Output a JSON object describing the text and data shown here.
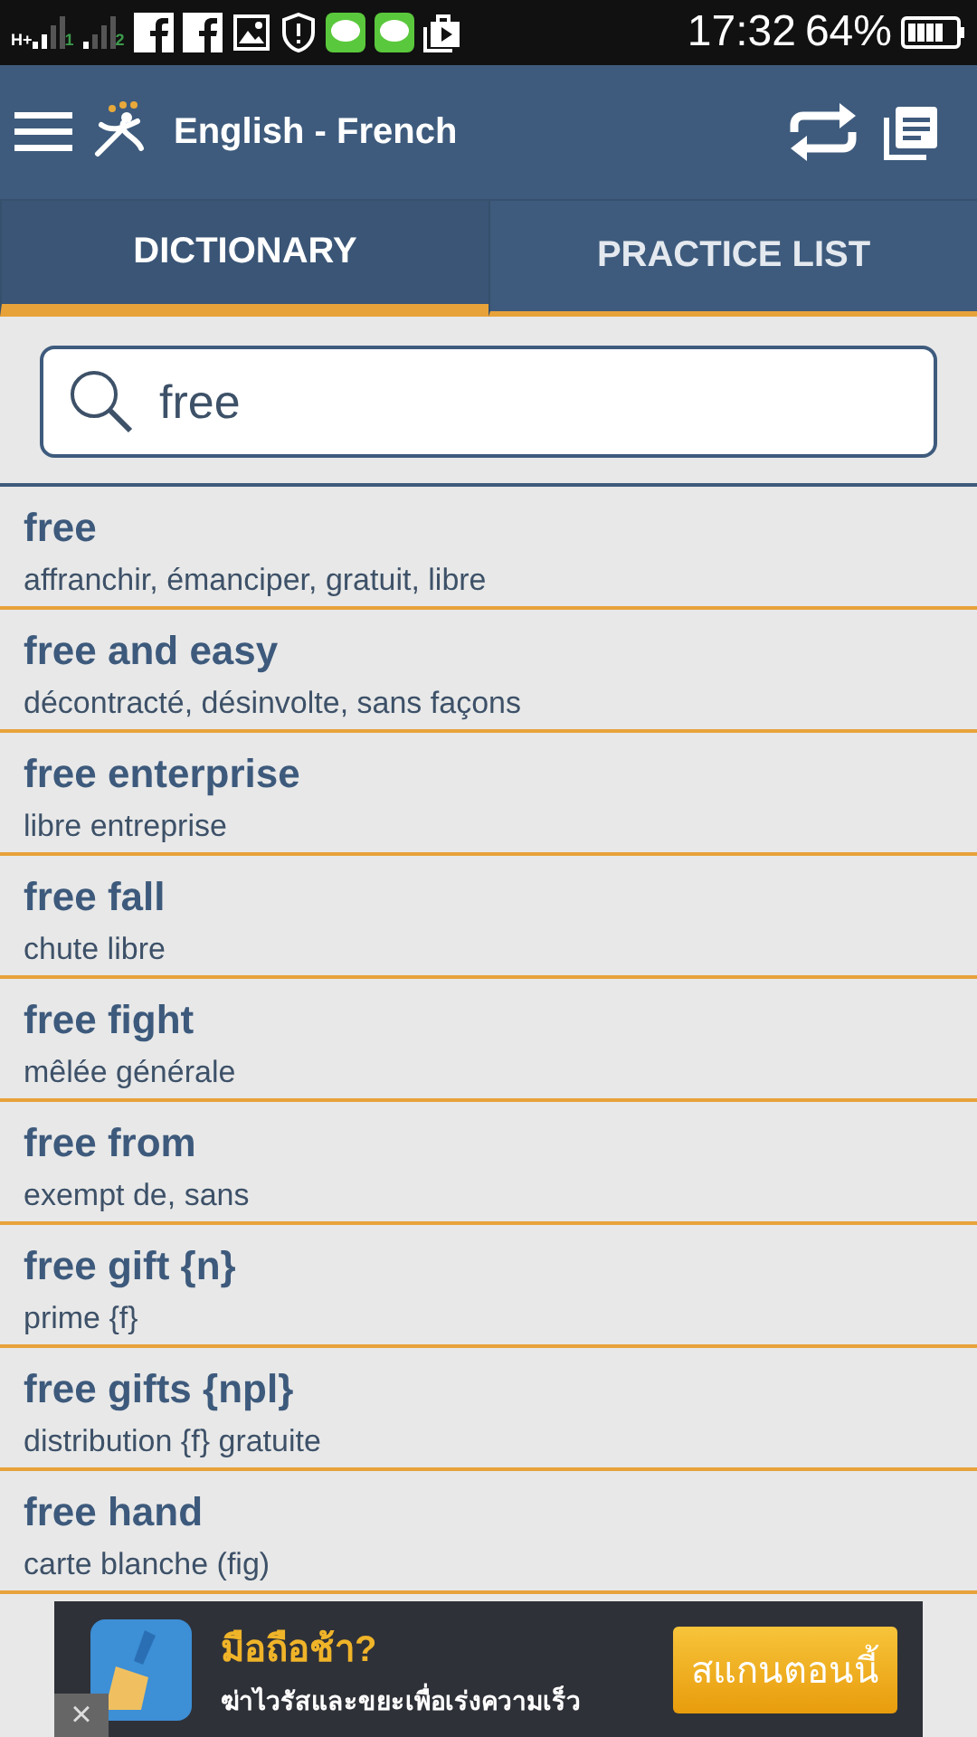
{
  "status_bar": {
    "network": "H+",
    "sim_1": "1",
    "sim_2": "2",
    "time": "17:32",
    "battery": "64%"
  },
  "app_bar": {
    "title": "English - French"
  },
  "tabs": [
    {
      "label": "DICTIONARY",
      "selected": true
    },
    {
      "label": "PRACTICE LIST",
      "selected": false
    }
  ],
  "search": {
    "value": "free"
  },
  "results": [
    {
      "term": "free",
      "translation": "affranchir, émanciper, gratuit, libre"
    },
    {
      "term": "free and easy",
      "translation": "décontracté, désinvolte, sans façons"
    },
    {
      "term": "free enterprise",
      "translation": "libre entreprise"
    },
    {
      "term": "free fall",
      "translation": "chute libre"
    },
    {
      "term": "free fight",
      "translation": "mêlée générale"
    },
    {
      "term": "free from",
      "translation": "exempt de, sans"
    },
    {
      "term": "free gift {n}",
      "translation": "prime {f}"
    },
    {
      "term": "free gifts {npl}",
      "translation": "distribution {f} gratuite"
    },
    {
      "term": "free hand",
      "translation": "carte blanche (fig)"
    }
  ],
  "ad": {
    "headline": "มือถือช้า?",
    "text": "ฆ่าไวรัสและขยะเพื่อเร่งความเร็ว",
    "button": "สแกนตอนนี้",
    "close": "×"
  }
}
